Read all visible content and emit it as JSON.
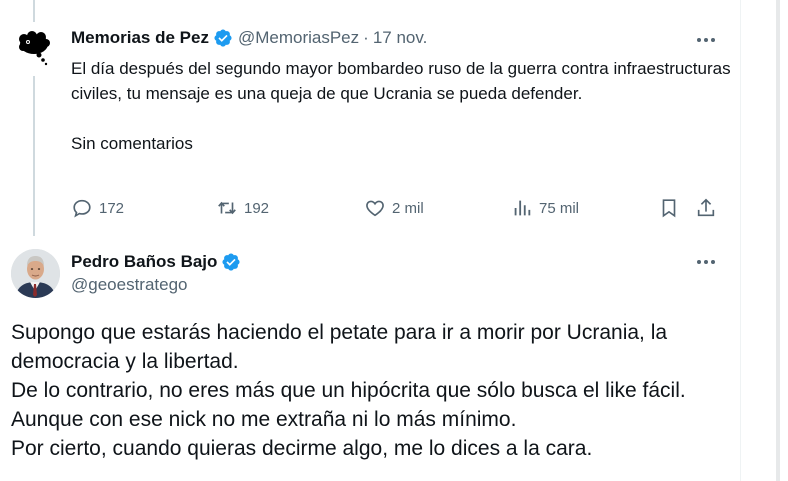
{
  "tweet_parent": {
    "author_name": "Memorias de Pez",
    "handle": "@MemoriasPez",
    "separator": "·",
    "date": "17 nov.",
    "avatar_icon": "black-fish-cloud-icon",
    "text": "El día después del segundo mayor bombardeo ruso de la guerra contra infraestructuras civiles, tu mensaje es una queja de que Ucrania se pueda defender.\n\nSin comentarios",
    "actions": {
      "replies": "172",
      "reposts": "192",
      "likes": "2 mil",
      "views": "75 mil"
    }
  },
  "tweet_reply": {
    "author_name": "Pedro Baños Bajo",
    "handle": "@geoestratego",
    "avatar_icon": "profile-photo-avatar",
    "text": "Supongo que estarás haciendo el petate para ir a morir por Ucrania, la democracia y la libertad.\nDe lo contrario, no eres más que un hipócrita que sólo busca el like fácil.\nAunque con ese nick no me extraña ni lo más mínimo.\nPor cierto, cuando quieras decirme algo, me lo dices a la cara."
  },
  "colors": {
    "verified": "#1d9bf0",
    "secondary_text": "#536471",
    "primary_text": "#0f1419",
    "thread_line": "#cfd9de"
  }
}
